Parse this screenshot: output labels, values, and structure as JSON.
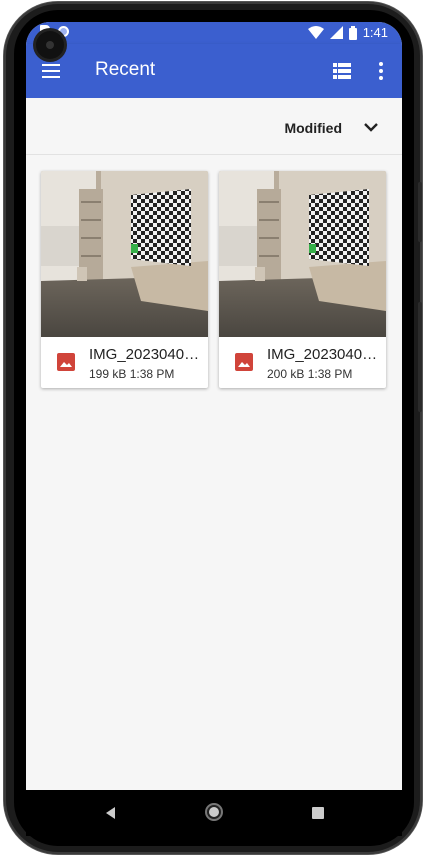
{
  "status_bar": {
    "time": "1:41",
    "icons": [
      "sd-card-icon",
      "circle-icon",
      "wifi-icon",
      "signal-icon",
      "battery-icon"
    ]
  },
  "app_bar": {
    "title": "Recent",
    "icons": [
      "menu-icon",
      "list-view-icon",
      "more-vert-icon"
    ],
    "color": "#3b5fcf"
  },
  "sort": {
    "label": "Modified",
    "icon": "chevron-down-icon"
  },
  "files": [
    {
      "name": "IMG_2023040…",
      "size": "199 kB",
      "time": "1:38 PM",
      "icon": "image-icon"
    },
    {
      "name": "IMG_2023040…",
      "size": "200 kB",
      "time": "1:38 PM",
      "icon": "image-icon"
    }
  ],
  "nav_bar": {
    "icons": [
      "back-icon",
      "home-icon",
      "recents-icon"
    ]
  },
  "colors": {
    "accent": "#3b5fcf",
    "image_icon": "#d0443a",
    "background": "#f6f6f6"
  }
}
